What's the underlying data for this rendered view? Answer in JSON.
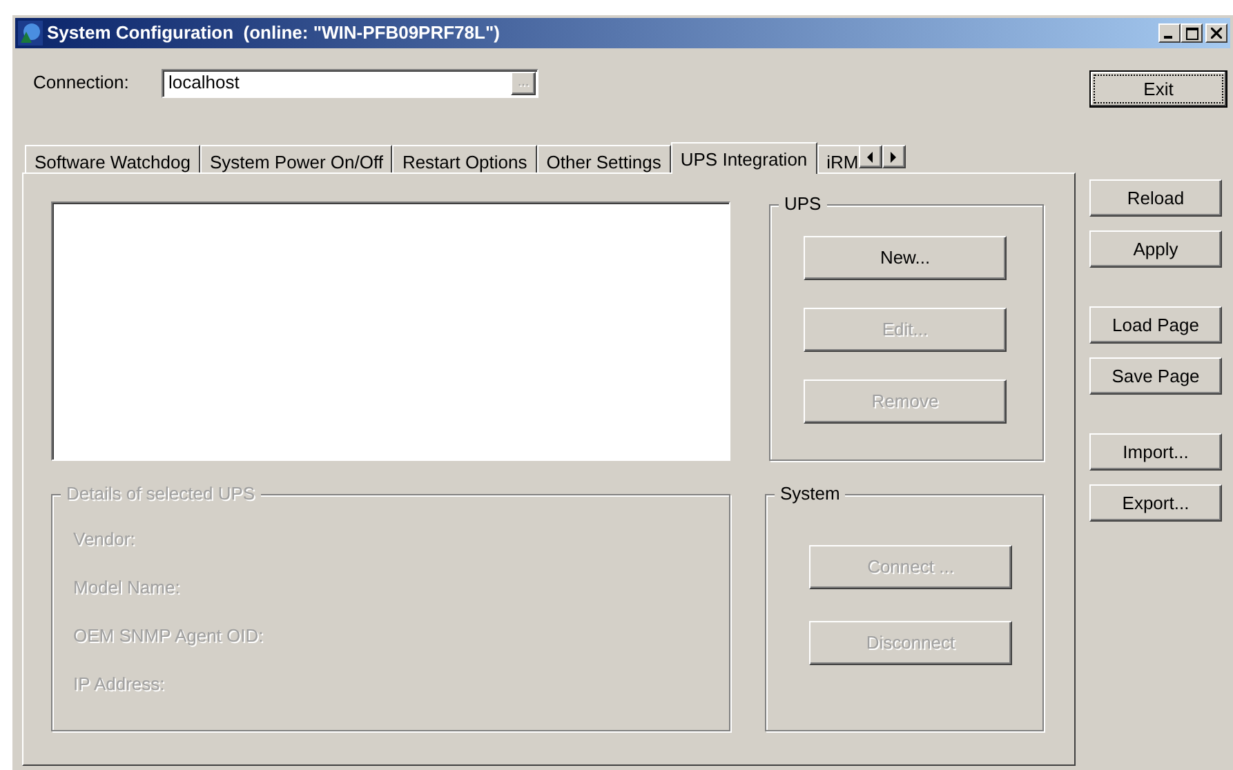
{
  "window": {
    "title": "System Configuration  (online: \"WIN-PFB09PRF78L\")"
  },
  "connection": {
    "label": "Connection:",
    "value": "localhost",
    "browse_label": "...",
    "browse_disabled": true
  },
  "tabs": [
    {
      "label": "Software Watchdog",
      "selected": false
    },
    {
      "label": "System Power On/Off",
      "selected": false
    },
    {
      "label": "Restart Options",
      "selected": false
    },
    {
      "label": "Other Settings",
      "selected": false
    },
    {
      "label": "UPS Integration",
      "selected": true
    },
    {
      "label": "iRM",
      "selected": false
    }
  ],
  "ups_group": {
    "title": "UPS",
    "buttons": [
      {
        "label": "New...",
        "disabled": false
      },
      {
        "label": "Edit...",
        "disabled": true
      },
      {
        "label": "Remove",
        "disabled": true
      }
    ]
  },
  "details_group": {
    "title": "Details of selected UPS",
    "disabled": true,
    "fields": [
      "Vendor:",
      "Model Name:",
      "OEM SNMP Agent OID:",
      "IP Address:"
    ]
  },
  "system_group": {
    "title": "System",
    "buttons": [
      {
        "label": "Connect ...",
        "disabled": true
      },
      {
        "label": "Disconnect",
        "disabled": true
      }
    ]
  },
  "side_buttons": [
    [
      {
        "label": "Exit",
        "focused": true
      }
    ],
    [
      {
        "label": "Reload",
        "focused": false
      },
      {
        "label": "Apply",
        "focused": false
      }
    ],
    [
      {
        "label": "Load Page",
        "focused": false
      },
      {
        "label": "Save Page",
        "focused": false
      }
    ],
    [
      {
        "label": "Import...",
        "focused": false
      },
      {
        "label": "Export...",
        "focused": false
      }
    ]
  ]
}
